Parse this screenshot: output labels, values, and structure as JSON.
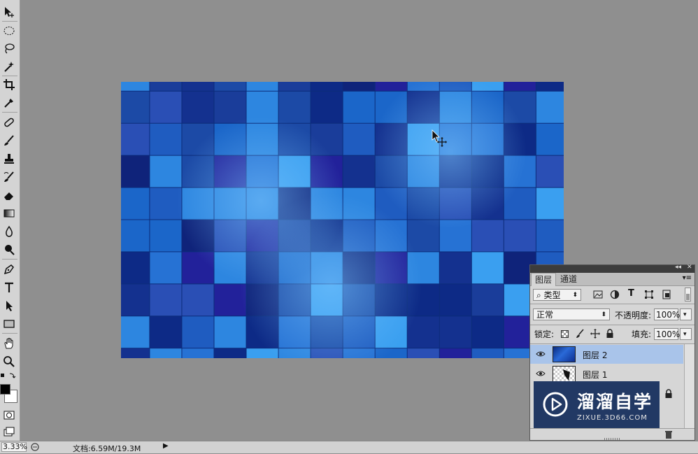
{
  "toolbar": {
    "tools": [
      {
        "name": "move-tool",
        "icon": "move-icon"
      },
      {
        "name": "marquee-tool",
        "icon": "ellipse-marquee-icon"
      },
      {
        "name": "lasso-tool",
        "icon": "lasso-icon"
      },
      {
        "name": "magic-wand-tool",
        "icon": "magic-wand-icon"
      },
      {
        "name": "crop-tool",
        "icon": "crop-icon"
      },
      {
        "name": "eyedropper-tool",
        "icon": "eyedropper-icon"
      },
      {
        "name": "healing-brush-tool",
        "icon": "bandage-icon"
      },
      {
        "name": "brush-tool",
        "icon": "brush-icon"
      },
      {
        "name": "clone-stamp-tool",
        "icon": "stamp-icon"
      },
      {
        "name": "history-brush-tool",
        "icon": "history-brush-icon"
      },
      {
        "name": "eraser-tool",
        "icon": "eraser-icon"
      },
      {
        "name": "gradient-tool",
        "icon": "gradient-icon"
      },
      {
        "name": "blur-tool",
        "icon": "drop-icon"
      },
      {
        "name": "dodge-tool",
        "icon": "dodge-icon"
      },
      {
        "name": "pen-tool",
        "icon": "pen-icon"
      },
      {
        "name": "type-tool",
        "icon": "type-icon"
      },
      {
        "name": "path-selection-tool",
        "icon": "arrow-icon"
      },
      {
        "name": "shape-tool",
        "icon": "rectangle-icon"
      },
      {
        "name": "hand-tool",
        "icon": "hand-icon"
      },
      {
        "name": "zoom-tool",
        "icon": "zoom-icon"
      }
    ],
    "foreground_color": "#000000",
    "background_color": "#ffffff"
  },
  "layers_panel": {
    "tabs": [
      "图层",
      "通道"
    ],
    "active_tab": "图层",
    "filter_kind": "类型",
    "blend_mode": "正常",
    "opacity_label": "不透明度:",
    "opacity_value": "100%",
    "lock_label": "锁定:",
    "fill_label": "填充:",
    "fill_value": "100%",
    "layers": [
      {
        "name": "图层 2",
        "visible": true,
        "selected": true
      },
      {
        "name": "图层 1",
        "visible": true,
        "selected": false
      }
    ]
  },
  "watermark": {
    "title": "溜溜自学",
    "subtitle": "ZIXUE.3D66.COM"
  },
  "status_bar": {
    "zoom": "3.33%",
    "doc_info": "文档:6.59M/19.3M"
  },
  "colors": {
    "workspace": "#8f8f8f",
    "selected_layer": "#a9c4ea",
    "watermark_bg": "#223964"
  }
}
